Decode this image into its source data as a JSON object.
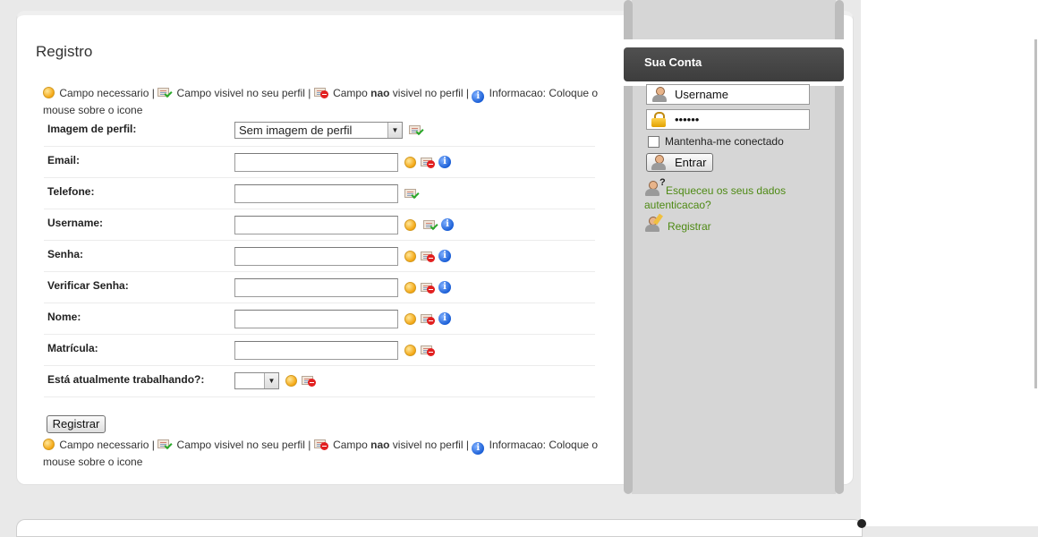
{
  "page": {
    "title": "Registro"
  },
  "legend": {
    "required": "Campo necessario |",
    "visible": "Campo visivel no seu perfil |",
    "invisible_pre": "Campo",
    "invisible_bold": "nao",
    "invisible_post": "visivel no perfil |",
    "info": "Informacao: Coloque o mouse sobre o icone"
  },
  "form": {
    "profile_image_label": "Imagem de perfil:",
    "profile_image_value": "Sem imagem de perfil",
    "email_label": "Email:",
    "phone_label": "Telefone:",
    "username_label": "Username:",
    "password_label": "Senha:",
    "verify_password_label": "Verificar Senha:",
    "name_label": "Nome:",
    "registration_label": "Matrícula:",
    "working_label": "Está atualmente trabalhando?:",
    "working_value": "",
    "submit_label": "Registrar"
  },
  "sidebar": {
    "title": "Sua Conta",
    "username_value": "Username",
    "password_value": "••••••",
    "remember_label": "Mantenha-me conectado",
    "enter_label": "Entrar",
    "forgot_label": "Esqueceu os seus dados autenticacao?",
    "register_label": "Registrar"
  },
  "icons": {
    "required": "required-field-icon",
    "visible": "visible-field-icon",
    "invisible": "invisible-field-icon",
    "info": "info-icon",
    "user": "user-icon",
    "lock": "lock-icon"
  },
  "colors": {
    "link": "#4e8a14",
    "sidebar": "#d6d6d6",
    "header": "#444444"
  }
}
